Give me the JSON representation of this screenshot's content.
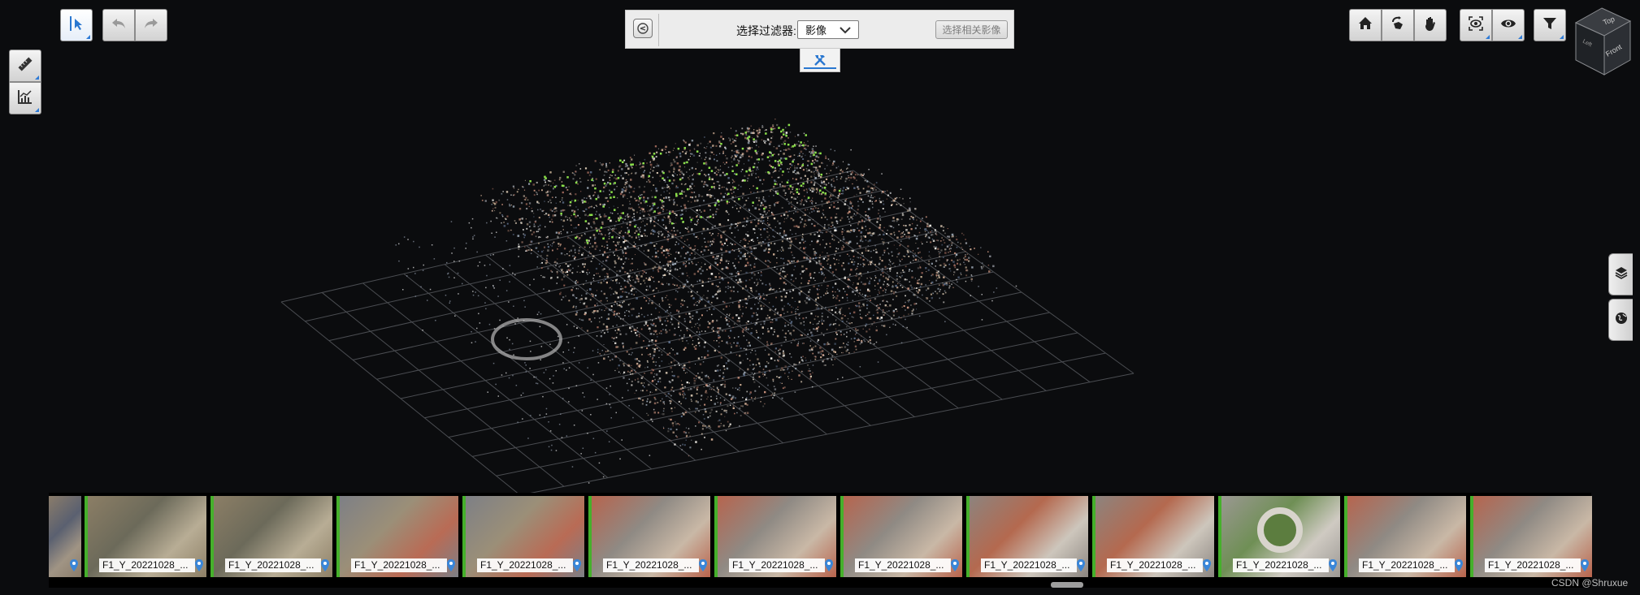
{
  "filter": {
    "label": "选择过滤器:",
    "selected": "影像",
    "related_button": "选择相关影像"
  },
  "toolbar": {
    "select_icon": "cursor-select-icon",
    "undo_icon": "undo-icon",
    "redo_icon": "redo-icon",
    "measure_icon": "ruler-icon",
    "chart_icon": "chart-measure-icon",
    "home_icon": "home-icon",
    "orbit_icon": "orbit-icon",
    "pan_icon": "hand-icon",
    "view_icon": "camera-view-icon",
    "eye_icon": "eye-icon",
    "filter_icon": "funnel-icon",
    "tools_icon": "tools-icon"
  },
  "view_cube": {
    "top": "Top",
    "front": "Front",
    "left": "Left"
  },
  "side": {
    "layers_icon": "layers-icon",
    "globe_icon": "globe-icon"
  },
  "filmstrip": {
    "thumbnails": [
      {
        "label": "",
        "tone": "urban-partial"
      },
      {
        "label": "F1_Y_20221028_...",
        "tone": "earth-field"
      },
      {
        "label": "F1_Y_20221028_...",
        "tone": "earth-field"
      },
      {
        "label": "F1_Y_20221028_...",
        "tone": "earth-roof"
      },
      {
        "label": "F1_Y_20221028_...",
        "tone": "earth-roof"
      },
      {
        "label": "F1_Y_20221028_...",
        "tone": "red-roofs"
      },
      {
        "label": "F1_Y_20221028_...",
        "tone": "red-roofs"
      },
      {
        "label": "F1_Y_20221028_...",
        "tone": "red-roofs"
      },
      {
        "label": "F1_Y_20221028_...",
        "tone": "road"
      },
      {
        "label": "F1_Y_20221028_...",
        "tone": "road"
      },
      {
        "label": "F1_Y_20221028_...",
        "tone": "roundabout"
      },
      {
        "label": "F1_Y_20221028_...",
        "tone": "red-roofs"
      },
      {
        "label": "F1_Y_20221028_...",
        "tone": "red-roofs"
      }
    ]
  },
  "watermark": "CSDN @Shruxue",
  "colors": {
    "accent": "#2a77d0",
    "selection_bar": "#45b02b",
    "background": "#0b0c0e"
  }
}
